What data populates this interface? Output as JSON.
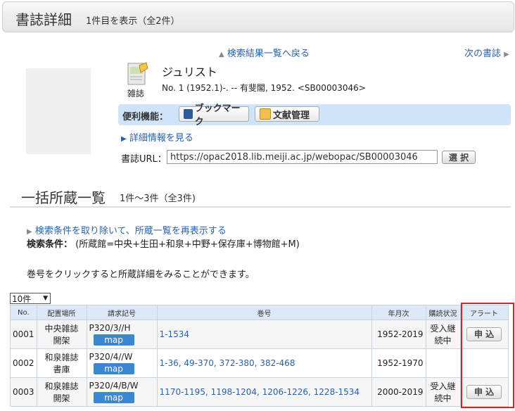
{
  "header": {
    "title": "書誌詳細",
    "count": "1件目を表示（全2件）"
  },
  "nav": {
    "back": "検索結果一覧へ戻る",
    "next": "次の書誌"
  },
  "record": {
    "type_label": "雑誌",
    "title": "ジュリスト",
    "description": "No. 1 (1952.1)-. -- 有斐閣, 1952. <SB00003046>",
    "tools_label": "便利機能：",
    "bookmark": "ブックマーク",
    "bibliography": "文献管理",
    "detail_link": "詳細情報を見る",
    "url_label": "書誌URL：",
    "url_value": "https://opac2018.lib.meiji.ac.jp/webopac/SB00003046",
    "select_label": "選 択"
  },
  "holdings": {
    "title": "一括所蔵一覧",
    "count": "1件～3件（全3件)",
    "reset_link": "検索条件を取り除いて、所蔵一覧を再表示する",
    "cond_label": "検索条件：",
    "cond_value": "(所蔵館=中央+生田+和泉+中野+保存庫+博物館+M)",
    "hint": "巻号をクリックすると所蔵詳細をみることができます。",
    "per_page": "10件",
    "columns": [
      "No.",
      "配置場所",
      "請求記号",
      "巻号",
      "年月次",
      "購読状況",
      "アラート"
    ],
    "map_label": "map",
    "apply_label": "申 込",
    "rows": [
      {
        "no": "0001",
        "loc1": "中央雑誌",
        "loc2": "開架",
        "call": "P320/3//H",
        "vol": "1-1534",
        "years": "1952-2019",
        "st1": "受入継",
        "st2": "続中",
        "alert": true
      },
      {
        "no": "0002",
        "loc1": "和泉雑誌",
        "loc2": "書庫",
        "call": "P320/4//W",
        "vol": "1-36, 49-370, 372-380, 382-468",
        "years": "1952-1970",
        "st1": "",
        "st2": "",
        "alert": false
      },
      {
        "no": "0003",
        "loc1": "和泉雑誌",
        "loc2": "開架",
        "call": "P320/4/B/W",
        "vol": "1170-1195, 1198-1204, 1206-1226, 1228-1534",
        "years": "2000-2019",
        "st1": "受入継",
        "st2": "続中",
        "alert": true
      }
    ]
  }
}
